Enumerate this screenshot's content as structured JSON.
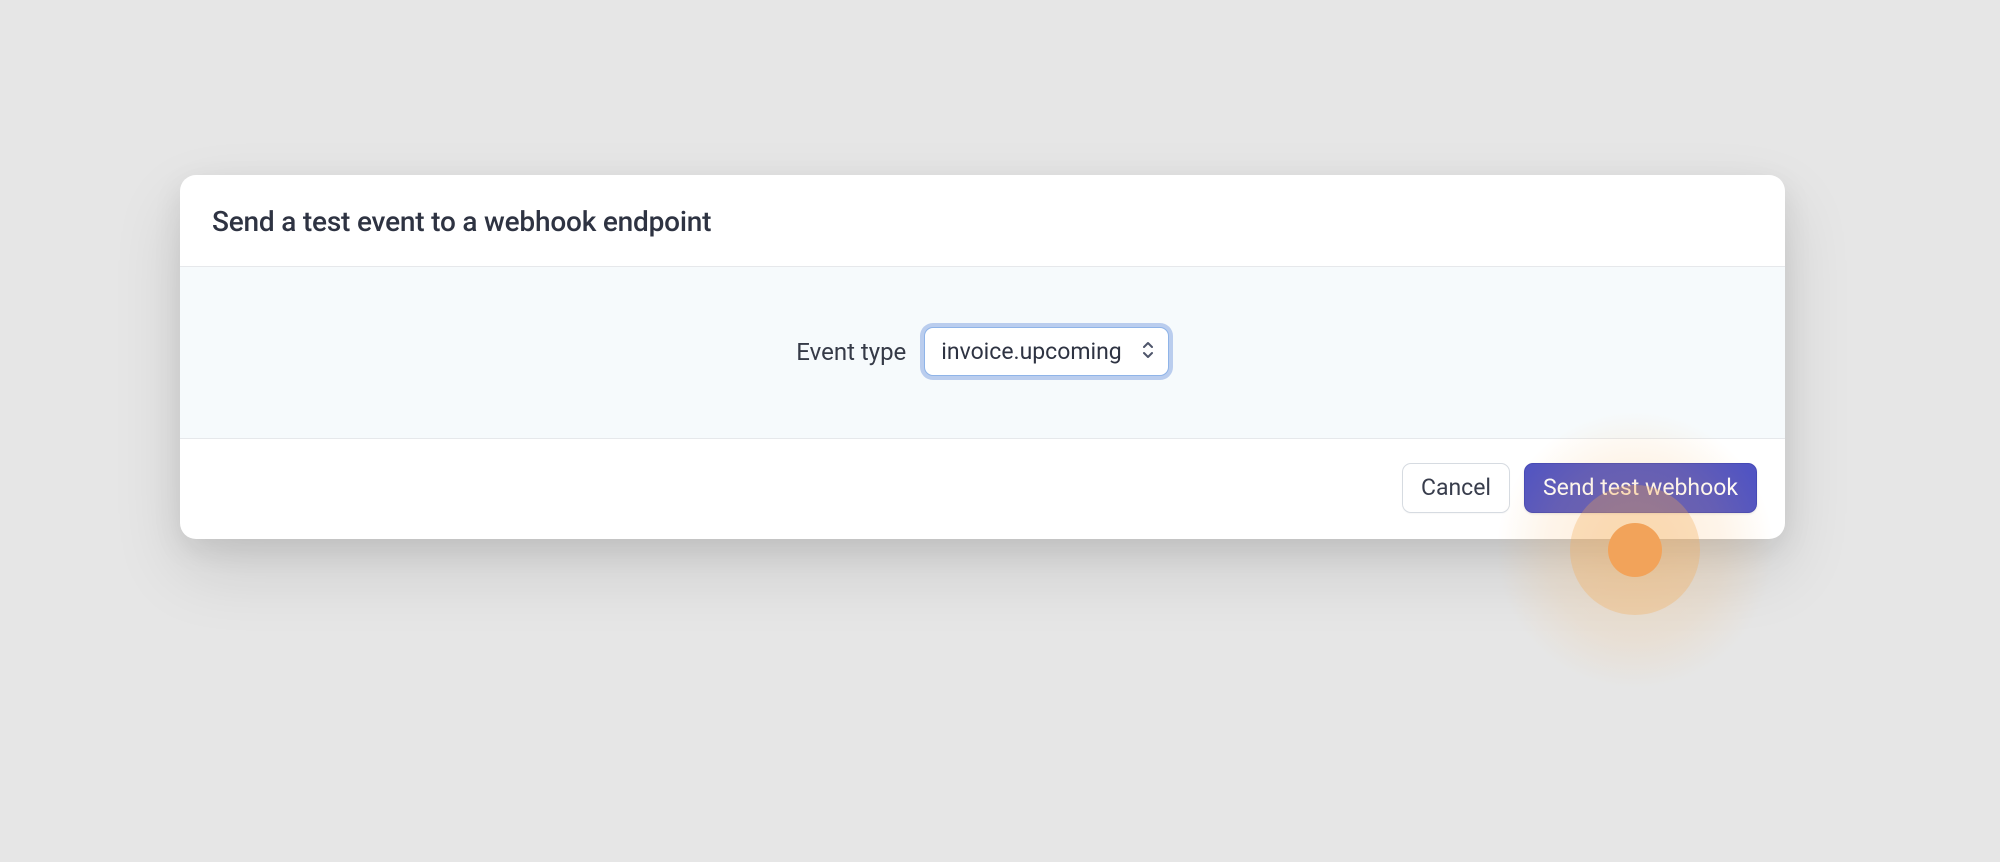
{
  "dialog": {
    "title": "Send a test event to a webhook endpoint",
    "event_type": {
      "label": "Event type",
      "selected_value": "invoice.upcoming"
    },
    "actions": {
      "cancel_label": "Cancel",
      "submit_label": "Send test webhook"
    }
  }
}
